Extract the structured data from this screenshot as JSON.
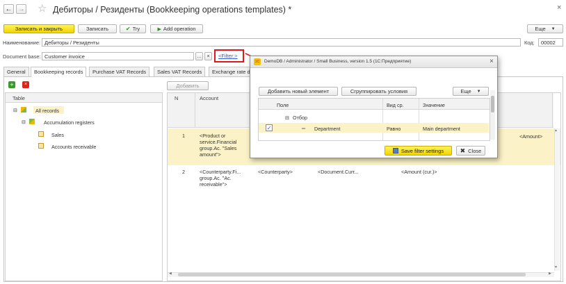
{
  "window": {
    "title": "Дебиторы / Резиденты (Bookkeeping operations templates) *",
    "close_glyph": "×"
  },
  "toolbar": {
    "save_close": "Записать и закрыть",
    "save": "Записать",
    "try": "Try",
    "add_operation": "Add operation",
    "more": "Еще"
  },
  "form": {
    "name_label": "Наименование:",
    "name_value": "Дебиторы / Резиденты",
    "code_label": "Код:",
    "code_value": "00002",
    "docbase_label": "Document base:",
    "docbase_value": "Customer invoice",
    "filter_link": "<Filter:>"
  },
  "tabs": [
    "General",
    "Bookkeeping records",
    "Purchase VAT Records",
    "Sales VAT Records",
    "Exchange rate di"
  ],
  "left_panel": {
    "header": "Table",
    "items": [
      {
        "label": "All records"
      },
      {
        "label": "Accumulation registers"
      },
      {
        "label": "Sales"
      },
      {
        "label": "Accounts receivable"
      }
    ]
  },
  "right_panel": {
    "add_button": "Добавить",
    "col_n": "N",
    "col_account": "Account",
    "rows": [
      {
        "n": "1",
        "account": [
          "<Product or",
          "service.Financial",
          "group.Ac. \"Sales",
          "amount\">"
        ],
        "amount": "<Amount>"
      },
      {
        "n": "2",
        "account": [
          "<Counterparty.Fi...",
          "group.Ac. \"Ac.",
          "receivable\">"
        ],
        "c2": "<Counterparty>",
        "c3": "<Document.Curr...",
        "c4": "<Amount (cur.)>"
      }
    ]
  },
  "dialog": {
    "title": "DemoDB / Administrator / Small Business, version 1.5 (1С:Предприятие)",
    "add_element": "Добавить новый элемент",
    "group_conditions": "Сгруппировать условия",
    "more": "Еще",
    "col_field": "Поле",
    "col_comparison": "Вид ср.",
    "col_value": "Значение",
    "group_label": "Отбор",
    "row_field": "Department",
    "row_comparison": "Равно",
    "row_value": "Main department",
    "save_button": "Save filter settings",
    "close_button": "Close"
  },
  "colors": {
    "accent_yellow": "#f5dc00",
    "selection_yellow": "#fbf3c7",
    "highlight_red": "#e0161b",
    "link_blue": "#2a5bd7"
  }
}
